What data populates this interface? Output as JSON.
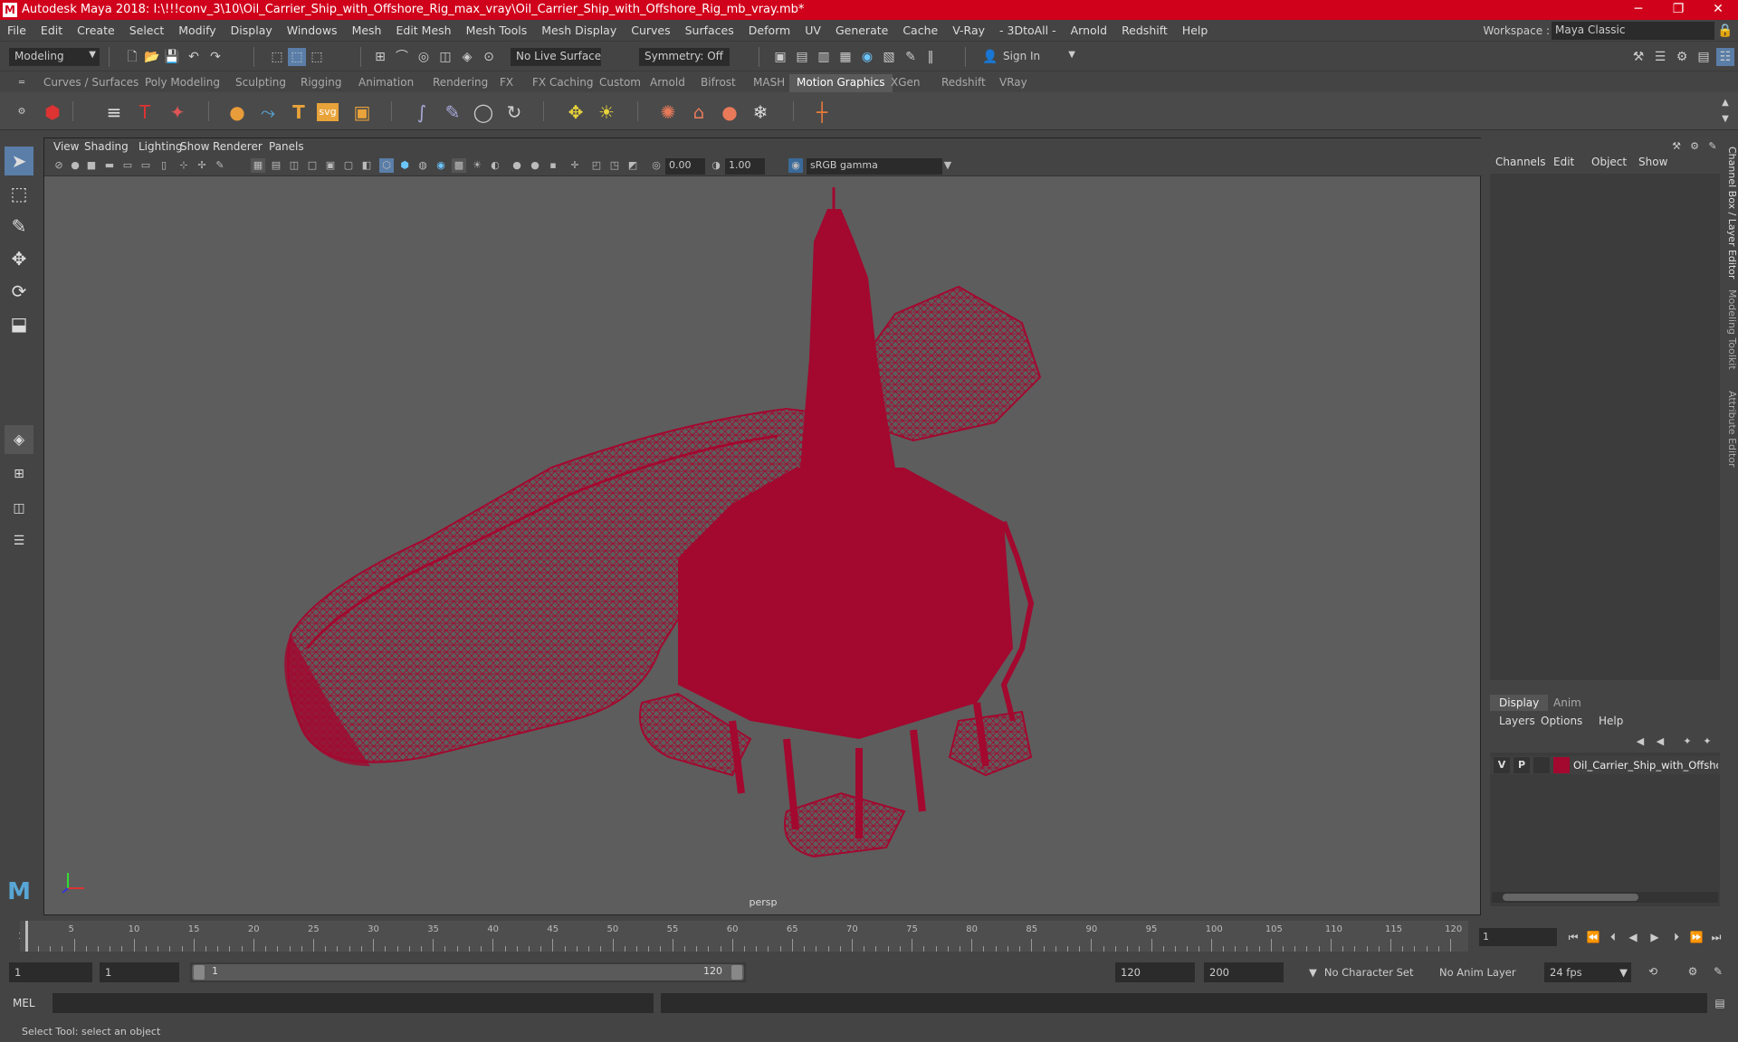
{
  "app": {
    "title": "Autodesk Maya 2018: I:\\!!!conv_3\\10\\Oil_Carrier_Ship_with_Offshore_Rig_max_vray\\Oil_Carrier_Ship_with_Offshore_Rig_mb_vray.mb*",
    "logo": "M"
  },
  "window_controls": {
    "minimize": "─",
    "maximize": "❐",
    "close": "✕"
  },
  "menu": [
    "File",
    "Edit",
    "Create",
    "Select",
    "Modify",
    "Display",
    "Windows",
    "Mesh",
    "Edit Mesh",
    "Mesh Tools",
    "Mesh Display",
    "Curves",
    "Surfaces",
    "Deform",
    "UV",
    "Generate",
    "Cache",
    "V-Ray",
    "- 3DtoAll -",
    "Arnold",
    "Redshift",
    "Help"
  ],
  "workspace": {
    "label": "Workspace :",
    "value": "Maya Classic"
  },
  "statusline": {
    "mode": "Modeling",
    "live_surface": "No Live Surface",
    "symmetry": "Symmetry: Off",
    "sign_in": "Sign In"
  },
  "shelf_tabs": [
    "Curves / Surfaces",
    "Poly Modeling",
    "Sculpting",
    "Rigging",
    "Animation",
    "Rendering",
    "FX",
    "FX Caching",
    "Custom",
    "Arnold",
    "Bifrost",
    "MASH",
    "Motion Graphics",
    "XGen",
    "Redshift",
    "VRay"
  ],
  "shelf_active": "Motion Graphics",
  "shelf_icons": [
    "T",
    "svg",
    "T"
  ],
  "viewport": {
    "menu": [
      "View",
      "Shading",
      "Lighting",
      "Show",
      "Renderer",
      "Panels"
    ],
    "exposure": "0.00",
    "gamma": "1.00",
    "colorspace": "sRGB gamma",
    "camera": "persp",
    "wire_color": "#a3082f"
  },
  "channel_box": {
    "menu": [
      "Channels",
      "Edit",
      "Object",
      "Show"
    ]
  },
  "layer_editor": {
    "tabs": [
      "Display",
      "Anim"
    ],
    "active_tab": "Display",
    "menu": [
      "Layers",
      "Options",
      "Help"
    ],
    "layers": [
      {
        "v": "V",
        "p": "P",
        "color": "#a3082f",
        "name": "Oil_Carrier_Ship_with_Offshor"
      }
    ]
  },
  "side_tabs": [
    "Channel Box / Layer Editor",
    "Modeling Toolkit",
    "Attribute Editor"
  ],
  "timeline": {
    "ticks": [
      5,
      10,
      15,
      20,
      25,
      30,
      35,
      40,
      45,
      50,
      55,
      60,
      65,
      70,
      75,
      80,
      85,
      90,
      95,
      100,
      105,
      110,
      115,
      120
    ],
    "start_label": "1",
    "current_frame": "1"
  },
  "range": {
    "start": "1",
    "playback_start": "1",
    "range_start": "1",
    "range_end": "120",
    "playback_end": "120",
    "end": "200",
    "character_set": "No Character Set",
    "anim_layer": "No Anim Layer",
    "fps": "24 fps"
  },
  "cmdline": {
    "label": "MEL"
  },
  "helpline": {
    "text": "Select Tool: select an object"
  }
}
